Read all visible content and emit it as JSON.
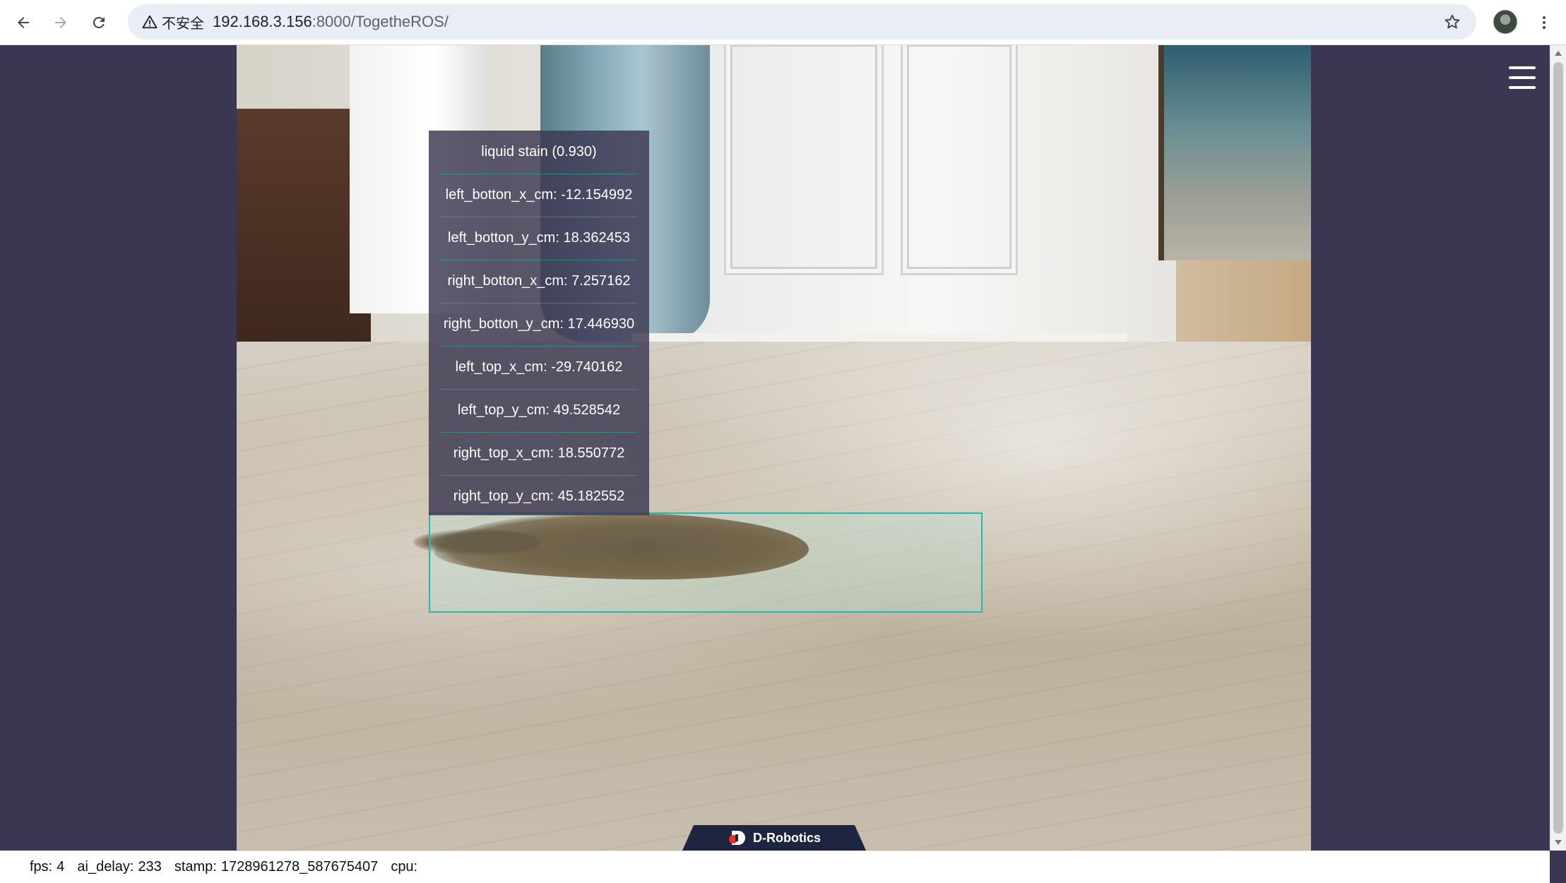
{
  "browser": {
    "security_label": "不安全",
    "url_host": "192.168.3.156",
    "url_rest": ":8000/TogetheROS/"
  },
  "detection": {
    "title": "liquid stain (0.930)",
    "fields": [
      "left_botton_x_cm: -12.154992",
      "left_botton_y_cm: 18.362453",
      "right_botton_x_cm: 7.257162",
      "right_botton_y_cm: 17.446930",
      "left_top_x_cm: -29.740162",
      "left_top_y_cm: 49.528542",
      "right_top_x_cm: 18.550772",
      "right_top_y_cm: 45.182552"
    ],
    "box_color": "#29b6ad"
  },
  "brand": {
    "name": "D-Robotics",
    "accent": "#e8312f"
  },
  "status": {
    "fps_label": "fps:",
    "fps_value": "4",
    "ai_delay_label": "ai_delay:",
    "ai_delay_value": "233",
    "stamp_label": "stamp:",
    "stamp_value": "1728961278_587675407",
    "cpu_label": "cpu:",
    "cpu_value": ""
  },
  "icons": {
    "back": "arrow-left-icon",
    "forward": "arrow-right-icon",
    "reload": "reload-icon",
    "warning": "warning-triangle-icon",
    "bookmark": "star-icon",
    "menu": "hamburger-menu-icon",
    "more": "vertical-dots-icon"
  },
  "colors": {
    "page_background": "#3b3752",
    "panel_background": "rgba(58,55,80,0.82)"
  }
}
